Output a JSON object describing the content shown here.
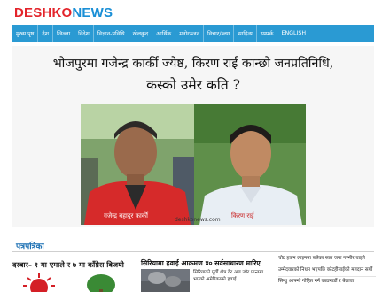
{
  "site": {
    "logo_part1": "DESHKO",
    "logo_part2": "NEWS"
  },
  "nav": {
    "items": [
      "मुख्य पृष्ठ",
      "देश",
      "जिल्ला",
      "विदेश",
      "विज्ञान-प्रविधि",
      "खेलकुद",
      "आर्थिक",
      "मनोरञ्जन",
      "विचार/ब्लग",
      "साहित्य",
      "सम्पर्क",
      "ENGLISH"
    ]
  },
  "hero": {
    "headline_line1": "भोजपुरमा गजेन्द्र कार्की ज्येष्ठ, किरण राई कान्छो जनप्रतिनिधि,",
    "headline_line2": "कस्को उमेर कति ?",
    "caption_left": "गजेन्द्र बहादुर कार्की",
    "caption_right": "किरण राई",
    "watermark": "deshkonews.com"
  },
  "section": {
    "title": "पत्रपत्रिका"
  },
  "articles": {
    "col1_headline": "दरबार– १ मा एमाले र ७ मा काँग्रेस विजयी",
    "col2_headline": "सिरियामा हवाई आक्रमण ४० सर्वसाधारण मारिए",
    "col2_summary": "सिरियाको पूर्वी क्षेत्र देर अल जोर प्रान्तमा भएको अमेरिकाको हवाई"
  },
  "sidebar_list": [
    "चोट हाल्न लाइनमा बसेका सात जना गम्भीर घाइते",
    "उम्मेदवारको निधन भएपछि कोटहीमाईको मतदान सर्यो",
    "सिन्धु आफ्नो गोहित गर्न काठमाडौं र बेलावा"
  ],
  "colors": {
    "nav_bg": "#2a9ad3",
    "logo_red": "#e3242b",
    "logo_blue": "#1a8fd6",
    "section_title": "#1a6fb3"
  },
  "icons": [
    "deshko-logo",
    "uml-party-sun-icon",
    "congress-tree-icon"
  ]
}
